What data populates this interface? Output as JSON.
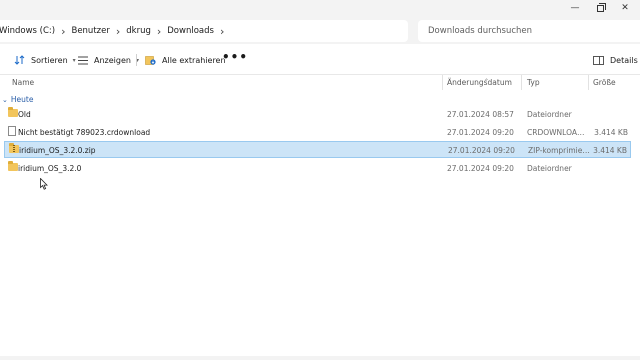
{
  "window": {
    "minimize_glyph": "—",
    "close_glyph": "✕"
  },
  "address": {
    "crumbs": [
      "Windows (C:)",
      "Benutzer",
      "dkrug",
      "Downloads"
    ],
    "separator": "›"
  },
  "search": {
    "placeholder": "Downloads durchsuchen"
  },
  "toolbar": {
    "sort_label": "Sortieren",
    "view_label": "Anzeigen",
    "extract_label": "Alle extrahieren",
    "more_label": "•••",
    "details_label": "Details"
  },
  "columns": {
    "name": "Name",
    "date": "Änderungsdatum",
    "type": "Typ",
    "size": "Größe"
  },
  "group": {
    "label": "Heute"
  },
  "files": [
    {
      "name": "Old",
      "date": "27.01.2024 08:57",
      "type": "Dateiordner",
      "size": "",
      "icon": "folder-icon",
      "selected": false
    },
    {
      "name": "Nicht bestätigt 789023.crdownload",
      "date": "27.01.2024 09:20",
      "type": "CRDOWNLOAD-D...",
      "size": "3.414 KB",
      "icon": "document-icon",
      "selected": false
    },
    {
      "name": "iridium_OS_3.2.0.zip",
      "date": "27.01.2024 09:20",
      "type": "ZIP-komprimierter...",
      "size": "3.414 KB",
      "icon": "zip-folder-icon",
      "selected": true
    },
    {
      "name": "iridium_OS_3.2.0",
      "date": "27.01.2024 09:20",
      "type": "Dateiordner",
      "size": "",
      "icon": "folder-icon",
      "selected": false
    }
  ],
  "colors": {
    "selection_bg": "#cce4f7",
    "selection_border": "#99c9ef",
    "group_text": "#2a5ea8",
    "folder": "#f2c55c"
  }
}
